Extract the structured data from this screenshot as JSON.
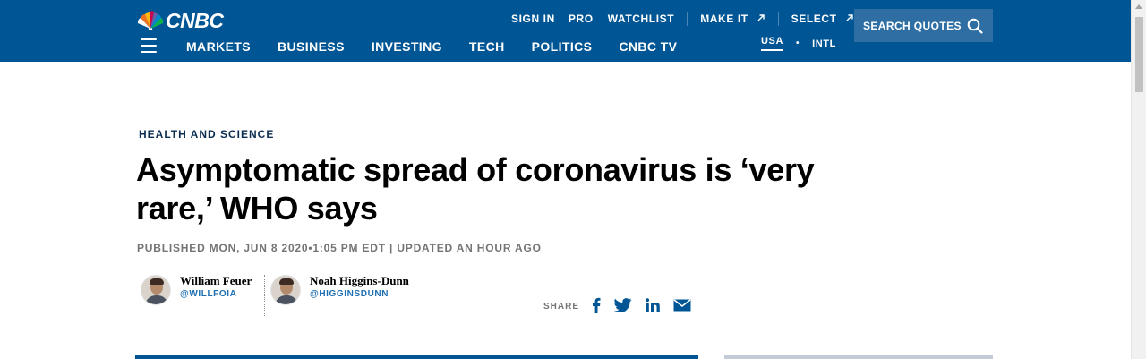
{
  "header": {
    "logo_text": "CNBC",
    "top_links": [
      {
        "label": "SIGN IN"
      },
      {
        "label": "PRO"
      },
      {
        "label": "WATCHLIST"
      },
      {
        "label": "MAKE IT"
      },
      {
        "label": "SELECT"
      }
    ],
    "main_nav": [
      {
        "label": "MARKETS"
      },
      {
        "label": "BUSINESS"
      },
      {
        "label": "INVESTING"
      },
      {
        "label": "TECH"
      },
      {
        "label": "POLITICS"
      },
      {
        "label": "CNBC TV"
      }
    ],
    "edition": {
      "current": "USA",
      "other": "INTL",
      "separator": "•"
    },
    "search_label": "SEARCH QUOTES",
    "colors": {
      "bar": "#005594",
      "search_bg": "#2e6ea3"
    }
  },
  "article": {
    "kicker": "HEALTH AND SCIENCE",
    "headline": "Asymptomatic spread of coronavirus is ‘very rare,’ WHO says",
    "published": "PUBLISHED MON, JUN 8 2020•1:05 PM EDT",
    "updated": "UPDATED AN HOUR AGO",
    "authors": [
      {
        "name": "William Feuer",
        "handle": "@WILLFOIA"
      },
      {
        "name": "Noah Higgins-Dunn",
        "handle": "@HIGGINSDUNN"
      }
    ],
    "share_label": "SHARE",
    "share_icons": [
      "facebook-icon",
      "twitter-icon",
      "linkedin-icon",
      "email-icon"
    ]
  }
}
